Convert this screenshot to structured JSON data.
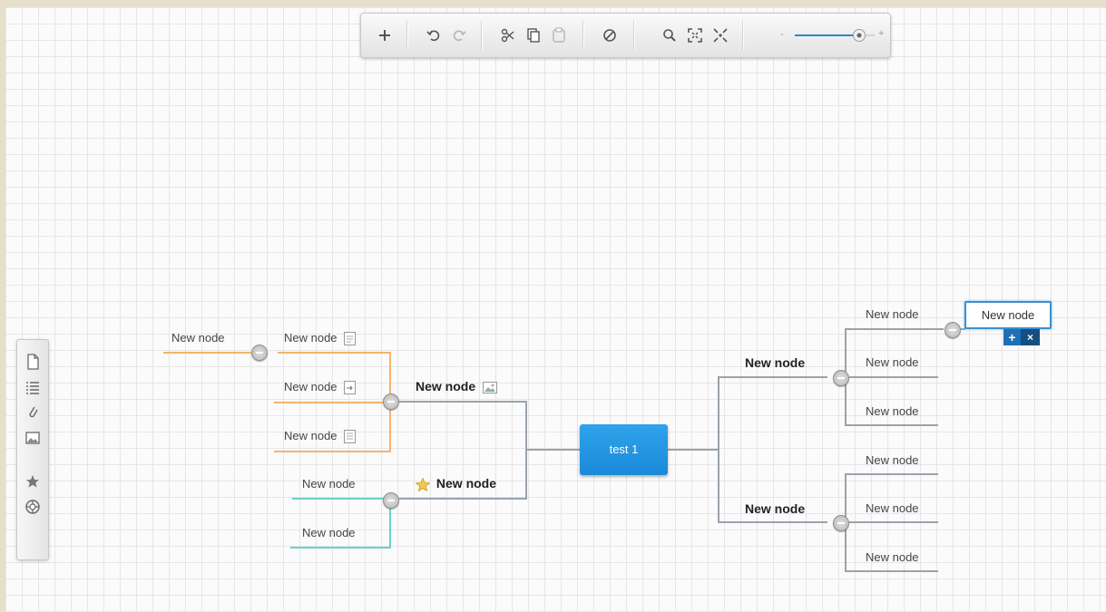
{
  "toolbar": {
    "icons": [
      "add-node-icon",
      "undo-icon",
      "redo-icon",
      "cut-icon",
      "copy-icon",
      "paste-icon",
      "delete-icon",
      "zoom-icon",
      "fit-to-screen-icon",
      "center-icon"
    ],
    "zoom_level": 0.8
  },
  "sidebar": {
    "icons": [
      "note-icon",
      "list-icon",
      "link-icon",
      "image-icon",
      "star-icon",
      "palette-icon"
    ]
  },
  "colors": {
    "root": "#1a8ad8",
    "left_top_branch": "#f3b46b",
    "left_bottom_branch": "#6ad3c6",
    "right_branches": "#9aa3ad"
  },
  "map": {
    "root": "test 1",
    "left": [
      {
        "label": "New node",
        "attachment": "image-icon",
        "children": [
          {
            "label": "New node",
            "attachment": "note-icon",
            "children": [
              {
                "label": "New node"
              }
            ]
          },
          {
            "label": "New node",
            "attachment": "link-icon"
          },
          {
            "label": "New node",
            "attachment": "list-icon"
          }
        ]
      },
      {
        "label": "New node",
        "attachment": "star-icon",
        "children": [
          {
            "label": "New node"
          },
          {
            "label": "New node"
          }
        ]
      }
    ],
    "right": [
      {
        "label": "New node",
        "children": [
          {
            "label": "New node",
            "children": [
              {
                "label": "New node",
                "editing": true
              }
            ]
          },
          {
            "label": "New node"
          },
          {
            "label": "New node"
          }
        ]
      },
      {
        "label": "New node",
        "children": [
          {
            "label": "New node"
          },
          {
            "label": "New node"
          },
          {
            "label": "New node"
          }
        ]
      }
    ],
    "edit_actions": {
      "add": "+",
      "remove": "×"
    }
  }
}
